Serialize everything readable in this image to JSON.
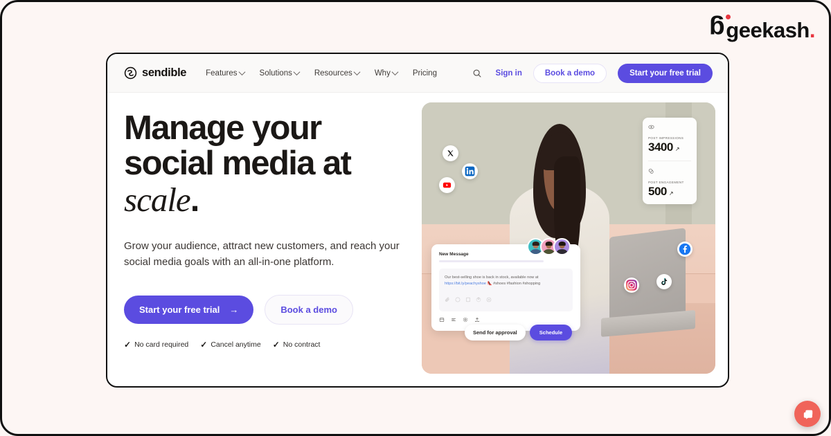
{
  "brand": {
    "name": "geekash",
    "dot": ".",
    "accent_color": "#e8353f"
  },
  "colors": {
    "page_background": "#fdf6f4",
    "frame_border": "#101010",
    "primary_purple": "#5b4ce0",
    "chat_coral": "#f0645a",
    "text_dark": "#1b1816"
  },
  "nav": {
    "logo_text": "sendible",
    "links": [
      {
        "label": "Features",
        "has_chevron": true
      },
      {
        "label": "Solutions",
        "has_chevron": true
      },
      {
        "label": "Resources",
        "has_chevron": true
      },
      {
        "label": "Why",
        "has_chevron": true
      },
      {
        "label": "Pricing",
        "has_chevron": false
      }
    ],
    "search_icon": "search-icon",
    "signin_label": "Sign in",
    "demo_label": "Book a demo",
    "trial_label": "Start your free trial"
  },
  "hero": {
    "headline_line1": "Manage your",
    "headline_line2": "social media at",
    "headline_italic": "scale",
    "headline_period": ".",
    "subhead": "Grow your audience, attract new customers, and reach your social media goals with an all-in-one platform.",
    "primary_cta": "Start your free trial",
    "primary_cta_arrow": "→",
    "secondary_cta": "Book a demo",
    "assurances": [
      {
        "check": "✓",
        "label": "No card required"
      },
      {
        "check": "✓",
        "label": "Cancel anytime"
      },
      {
        "check": "✓",
        "label": "No contract"
      }
    ]
  },
  "stats": [
    {
      "icon": "eye-icon",
      "label": "POST IMPRESSIONS",
      "value": "3400",
      "arrow": "↗"
    },
    {
      "icon": "engagement-icon",
      "label": "POST ENGAGEMENT",
      "value": "500",
      "arrow": "↗"
    }
  ],
  "social_badges": [
    {
      "id": "soc-x",
      "name": "x-twitter-icon",
      "platform": "X"
    },
    {
      "id": "soc-linkedin",
      "name": "linkedin-icon",
      "platform": "LinkedIn"
    },
    {
      "id": "soc-youtube",
      "name": "youtube-icon",
      "platform": "YouTube"
    },
    {
      "id": "soc-facebook",
      "name": "facebook-icon",
      "platform": "Facebook"
    },
    {
      "id": "soc-tiktok",
      "name": "tiktok-icon",
      "platform": "TikTok"
    },
    {
      "id": "soc-instagram",
      "name": "instagram-icon",
      "platform": "Instagram"
    }
  ],
  "avatars": [
    {
      "bg": "#3fbfc4",
      "hair": "#2b1f1a",
      "skin": "#b0765a",
      "shirt": "#3f5f86"
    },
    {
      "bg": "#f0a0bd",
      "hair": "#241a14",
      "skin": "#a9734f",
      "shirt": "#4e5434"
    },
    {
      "bg": "#a98ae0",
      "hair": "#1d1511",
      "skin": "#9a6a4a",
      "shirt": "#2e2a33"
    }
  ],
  "composer": {
    "title": "New Message",
    "text_plain": "Our best-selling shoe is back in stock, available now at ",
    "text_link": "https://bit.ly/peachyshoe",
    "text_emoji": " 👠 ",
    "text_tags": "#shoes #fashion #shopping",
    "inner_icons": [
      "attachment-icon",
      "emoji-icon",
      "image-icon",
      "link-icon",
      "location-icon"
    ],
    "outer_icons": [
      "calendar-icon",
      "queue-icon",
      "settings-icon",
      "upload-icon"
    ],
    "approval_button": "Send for approval",
    "schedule_button": "Schedule"
  },
  "chat": {
    "icon": "chat-bubble-icon",
    "label": "Open chat"
  }
}
